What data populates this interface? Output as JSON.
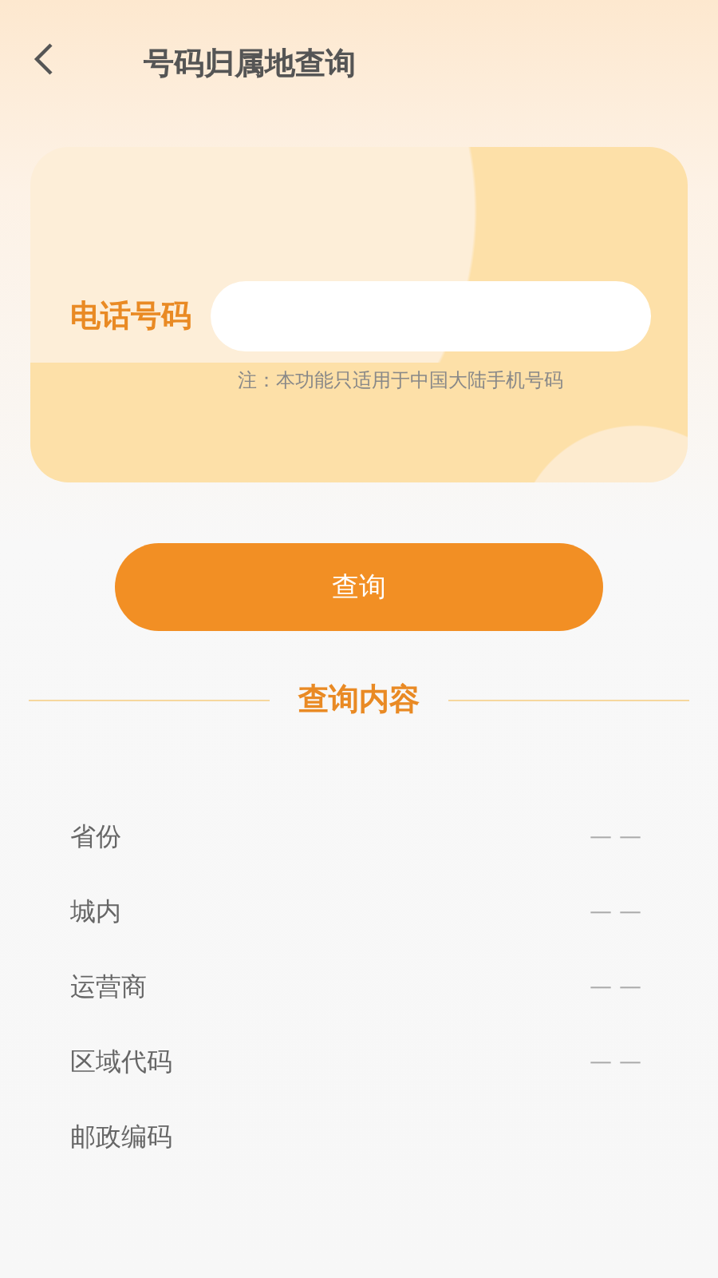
{
  "header": {
    "title": "号码归属地查询"
  },
  "form": {
    "label": "电话号码",
    "note": "注：本功能只适用于中国大陆手机号码"
  },
  "query_button": "查询",
  "section_title": "查询内容",
  "results": [
    {
      "label": "省份",
      "value": "— —"
    },
    {
      "label": "城内",
      "value": "— —"
    },
    {
      "label": "运营商",
      "value": "— —"
    },
    {
      "label": "区域代码",
      "value": "— —"
    },
    {
      "label": "邮政编码"
    }
  ]
}
